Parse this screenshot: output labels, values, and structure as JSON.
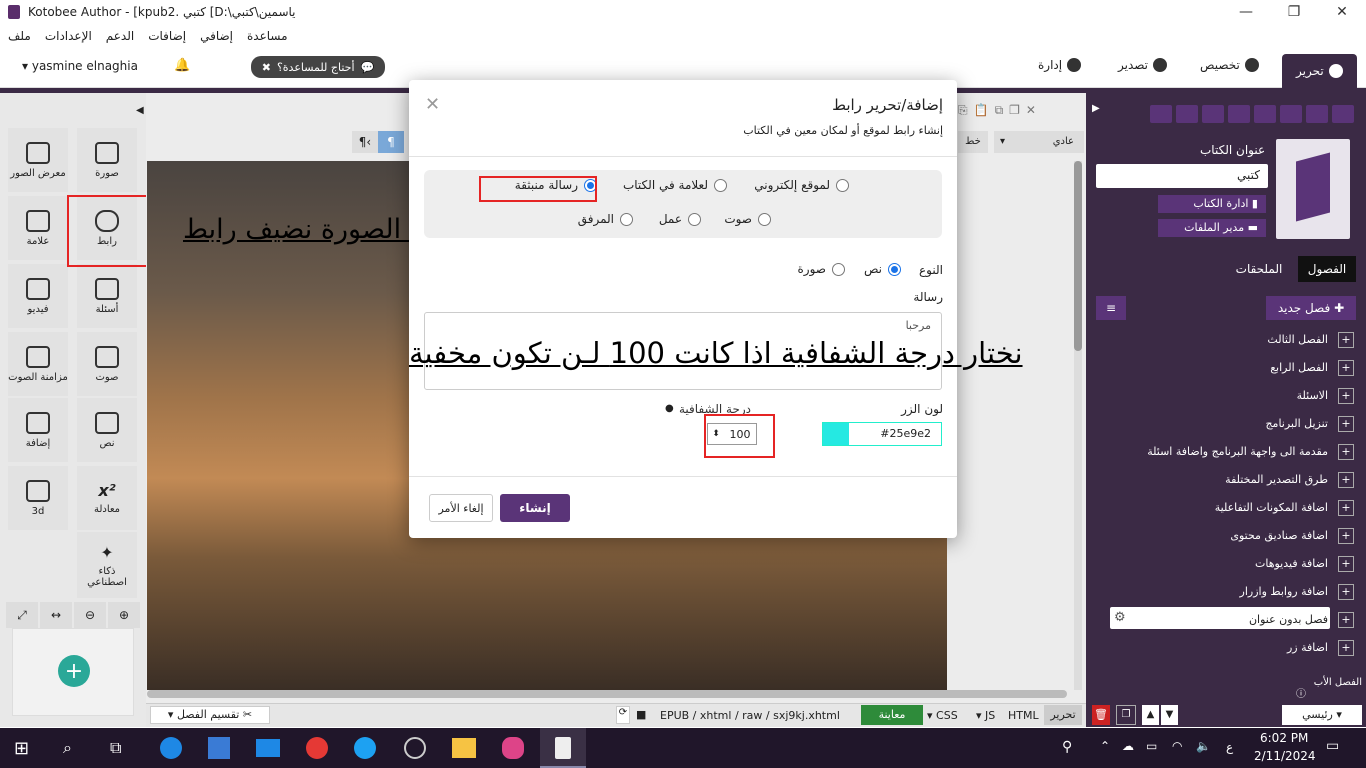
{
  "window": {
    "title": "Kotobee Author - [kpub2. كتبي [D:\\ياسمين\\كتبي",
    "minimize": "—",
    "maximize": "❐",
    "close": "✕"
  },
  "menu": [
    "ملف",
    "الإعدادات",
    "الدعم",
    "إضافات",
    "إضافي",
    "مساعدة"
  ],
  "topbar": {
    "user": "yasmine elnaghia",
    "help_label": "أحتاج للمساعدة؟",
    "tabs": [
      "تحرير",
      "تخصيص",
      "تصدير",
      "إدارة"
    ]
  },
  "left_tools": [
    {
      "label": "صورة",
      "icon": "image-icon"
    },
    {
      "label": "معرض الصور",
      "icon": "gallery-icon"
    },
    {
      "label": "رابط",
      "icon": "link-icon"
    },
    {
      "label": "علامة",
      "icon": "bookmark-icon"
    },
    {
      "label": "أسئلة",
      "icon": "questions-icon"
    },
    {
      "label": "فيديو",
      "icon": "video-icon"
    },
    {
      "label": "صوت",
      "icon": "audio-icon"
    },
    {
      "label": "مزامنة الصوت",
      "icon": "audio-sync-icon"
    },
    {
      "label": "نص",
      "icon": "text-icon"
    },
    {
      "label": "إضافة",
      "icon": "widget-icon"
    },
    {
      "label": "معادلة",
      "icon": "equation-icon"
    },
    {
      "label": "3d",
      "icon": "cube-icon"
    },
    {
      "label": "ذكاء اصطناعي",
      "icon": "ai-wand-icon"
    }
  ],
  "editor_toolbar": {
    "paragraph_style": "عادي",
    "font": "خط"
  },
  "annotations": {
    "top": "بعد اضافة الصورة نضيف رابط",
    "middle": "نختار درجة الشفافية اذا كانت 100 لـن تكون مخفية"
  },
  "dialog": {
    "title": "إضافة/تحرير رابط",
    "subtitle": "إنشاء رابط لموقع أو لمكان معين في الكتاب",
    "link_types": {
      "website": "لموقع إلكتروني",
      "bookmark": "لعلامة في الكتاب",
      "popup": "رسالة منبثقة",
      "audio": "صوت",
      "action": "عمل",
      "attachment": "المرفق"
    },
    "selected_type": "رسالة منبثقة",
    "kind_label": "النوع",
    "kind_text": "نص",
    "kind_image": "صورة",
    "message_label": "رسالة",
    "message_value": "مرحبا",
    "button_color_label": "لون الزر",
    "button_color_value": "#25e9e2",
    "opacity_label": "درجة الشفافية",
    "opacity_value": "100",
    "create_button": "إنشاء",
    "cancel_button": "إلغاء الأمر"
  },
  "right_panel": {
    "book_title_label": "عنوان الكتاب",
    "book_title_value": "كتبي",
    "manage_book": "ادارة الكتاب",
    "file_manager": "مدير الملفات",
    "tab_chapters": "الفصول",
    "tab_attachments": "الملحقات",
    "new_chapter": "فصل جديد",
    "chapters": [
      "الفصل الثالث",
      "الفصل الرابع",
      "الاسئلة",
      "تنزيل البرنامج",
      "مقدمة الى واجهة البرنامج واضافة اسئلة",
      "طرق التصدير المختلفة",
      "اضافة المكونات التفاعلية",
      "اضافة صناديق محتوى",
      "اضافة فيديوهات",
      "اضافة روابط وازرار",
      "فصل بدون عنوان",
      "اضافة زر"
    ],
    "parent_chapter_label": "الفصل الأب",
    "parent_chapter_value": "رئيسي"
  },
  "statusbar": {
    "split_chapter": "تقسيم الفصل",
    "path": "EPUB / xhtml / raw / sxj9kj.xhtml",
    "preview": "معاينة",
    "css": "CSS",
    "js": "JS",
    "html": "HTML",
    "edit": "تحرير"
  },
  "taskbar": {
    "time": "6:02 PM",
    "date": "2/11/2024",
    "lang": "ع"
  },
  "colors": {
    "purple": "#3b2a45",
    "accent_purple": "#5a3478",
    "preview_green": "#2e8b3a",
    "highlight_red": "#e52424",
    "swatch": "#25e9e2"
  }
}
